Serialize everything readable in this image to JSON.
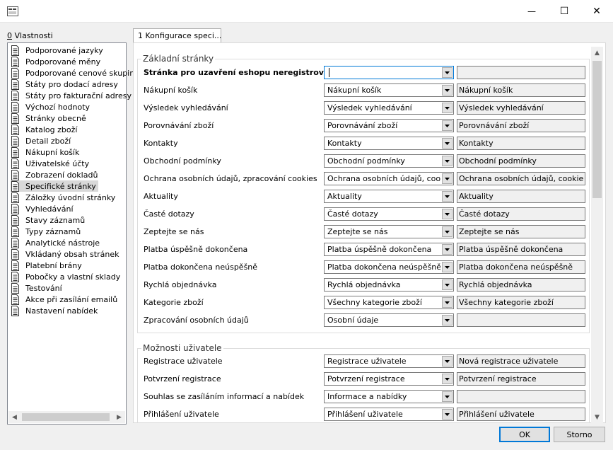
{
  "window": {
    "min_glyph": "—",
    "max_glyph": "☐",
    "close_glyph": "✕"
  },
  "properties": {
    "label_mnemonic": "0",
    "label_rest": " Vlastnosti",
    "items": [
      {
        "label": "Podporované jazyky"
      },
      {
        "label": "Podporované měny"
      },
      {
        "label": "Podporované cenové skupiny"
      },
      {
        "label": "Státy pro dodací adresy"
      },
      {
        "label": "Státy pro fakturační adresy"
      },
      {
        "label": "Výchozí hodnoty"
      },
      {
        "label": "Stránky obecně"
      },
      {
        "label": "Katalog zboží"
      },
      {
        "label": "Detail zboží"
      },
      {
        "label": "Nákupní košík"
      },
      {
        "label": "Uživatelské účty"
      },
      {
        "label": "Zobrazení dokladů"
      },
      {
        "label": "Specifické stránky",
        "selected": true
      },
      {
        "label": "Záložky úvodní stránky"
      },
      {
        "label": "Vyhledávání"
      },
      {
        "label": "Stavy záznamů"
      },
      {
        "label": "Typy záznamů"
      },
      {
        "label": "Analytické nástroje"
      },
      {
        "label": "Vkládaný obsah stránek"
      },
      {
        "label": "Platební brány"
      },
      {
        "label": "Pobočky a vlastní sklady"
      },
      {
        "label": "Testování"
      },
      {
        "label": "Akce při zasílání emailů"
      },
      {
        "label": "Nastavení nabídek"
      }
    ]
  },
  "tab": {
    "label": "1 Konfigurace speci..."
  },
  "sections": {
    "basic": {
      "title": "Základní stránky",
      "rows": [
        {
          "label": "Stránka pro uzavření eshopu neregistrova...",
          "select": "",
          "text": ""
        },
        {
          "label": "Nákupní košík",
          "select": "Nákupní košík",
          "text": "Nákupní košík"
        },
        {
          "label": "Výsledek vyhledávání",
          "select": "Výsledek vyhledávání",
          "text": "Výsledek vyhledávání"
        },
        {
          "label": "Porovnávání zboží",
          "select": "Porovnávání zboží",
          "text": "Porovnávání zboží"
        },
        {
          "label": "Kontakty",
          "select": "Kontakty",
          "text": "Kontakty"
        },
        {
          "label": "Obchodní podmínky",
          "select": "Obchodní podmínky",
          "text": "Obchodní podmínky"
        },
        {
          "label": "Ochrana osobních údajů, zpracování cookies",
          "select": "Ochrana osobních údajů, cookie",
          "text": "Ochrana osobních údajů, cookie"
        },
        {
          "label": "Aktuality",
          "select": "Aktuality",
          "text": "Aktuality"
        },
        {
          "label": "Časté dotazy",
          "select": "Časté dotazy",
          "text": "Časté dotazy"
        },
        {
          "label": "Zeptejte se nás",
          "select": "Zeptejte se nás",
          "text": "Zeptejte se nás"
        },
        {
          "label": "Platba úspěšně dokončena",
          "select": "Platba úspěšně dokončena",
          "text": "Platba úspěšně dokončena"
        },
        {
          "label": "Platba dokončena neúspěšně",
          "select": "Platba dokončena neúspěšně",
          "text": "Platba dokončena neúspěšně"
        },
        {
          "label": "Rychlá objednávka",
          "select": "Rychlá objednávka",
          "text": "Rychlá objednávka"
        },
        {
          "label": "Kategorie zboží",
          "select": "Všechny kategorie zboží",
          "text": "Všechny kategorie zboží"
        },
        {
          "label": "Zpracování osobních údajů",
          "select": "Osobní údaje",
          "text": ""
        }
      ]
    },
    "user": {
      "title": "Možnosti uživatele",
      "rows": [
        {
          "label": "Registrace uživatele",
          "select": "Registrace uživatele",
          "text": "Nová registrace uživatele"
        },
        {
          "label": "Potvrzení registrace",
          "select": "Potvrzení registrace",
          "text": "Potvrzení registrace"
        },
        {
          "label": "Souhlas se zasíláním informací a nabídek",
          "select": "Informace a nabídky",
          "text": ""
        },
        {
          "label": "Přihlášení uživatele",
          "select": "Přihlášení uživatele",
          "text": "Přihlášení uživatele"
        }
      ]
    }
  },
  "buttons": {
    "ok": "OK",
    "cancel": "Storno"
  },
  "colors": {
    "accent": "#0078d7",
    "selection": "#d9d9d9"
  }
}
